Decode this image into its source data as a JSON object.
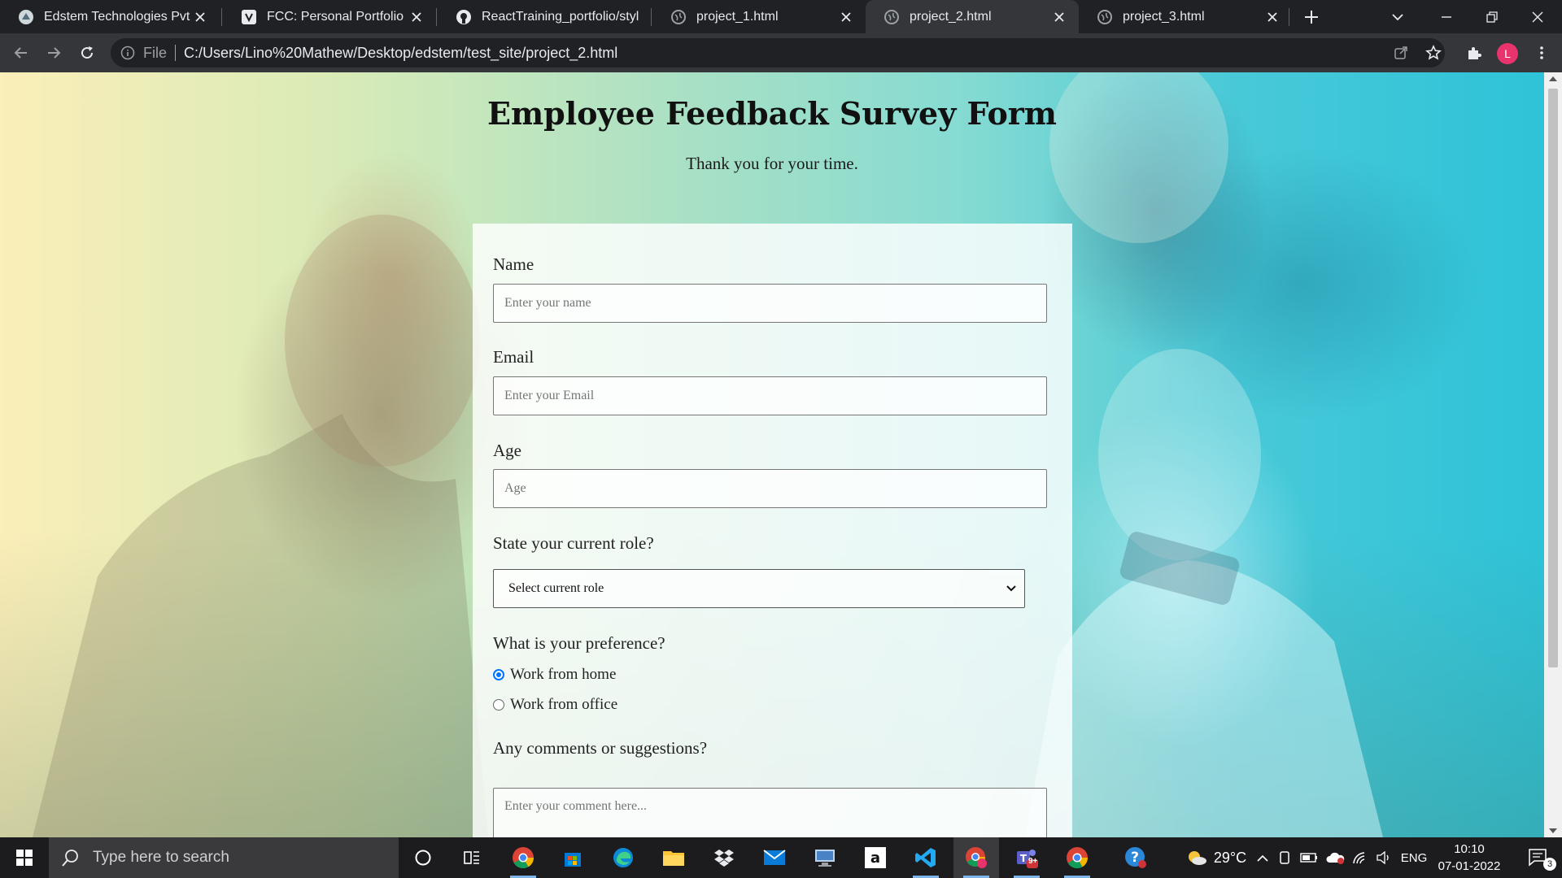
{
  "browser": {
    "tabs": [
      {
        "title": "Edstem Technologies Pvt Lt",
        "icon": "edstem-favicon-icon",
        "active": false
      },
      {
        "title": "FCC: Personal Portfolio",
        "icon": "freecodecamp-favicon-icon",
        "active": false
      },
      {
        "title": "ReactTraining_portfolio/styl",
        "icon": "github-favicon-icon",
        "active": false
      },
      {
        "title": "project_1.html",
        "icon": "globe-icon",
        "active": false
      },
      {
        "title": "project_2.html",
        "icon": "globe-icon",
        "active": true
      },
      {
        "title": "project_3.html",
        "icon": "globe-icon",
        "active": false
      }
    ],
    "address": {
      "scheme_label": "File",
      "url": "C:/Users/Lino%20Mathew/Desktop/edstem/test_site/project_2.html"
    },
    "profile_initial": "L"
  },
  "page": {
    "title": "Employee Feedback Survey Form",
    "description": "Thank you for your time.",
    "form": {
      "name_label": "Name",
      "name_placeholder": "Enter your name",
      "email_label": "Email",
      "email_placeholder": "Enter your Email",
      "age_label": "Age",
      "age_placeholder": "Age",
      "role_label": "State your current role?",
      "role_selected": "Select current role",
      "preference_label": "What is your preference?",
      "preference_options": [
        {
          "label": "Work from home",
          "checked": true
        },
        {
          "label": "Work from office",
          "checked": false
        }
      ],
      "comments_label": "Any comments or suggestions?",
      "comments_placeholder": "Enter your comment here..."
    }
  },
  "taskbar": {
    "search_placeholder": "Type here to search",
    "weather": "29°C",
    "language": "ENG",
    "time": "10:10",
    "date": "07-01-2022",
    "notification_count": "3",
    "teams_badge": "9+"
  },
  "colors": {
    "chrome_dark": "#202124",
    "chrome_tab_active": "#35363a",
    "form_panel": "#ffffff",
    "radio_accent": "#0075ff",
    "taskbar": "#1c1c1f"
  }
}
